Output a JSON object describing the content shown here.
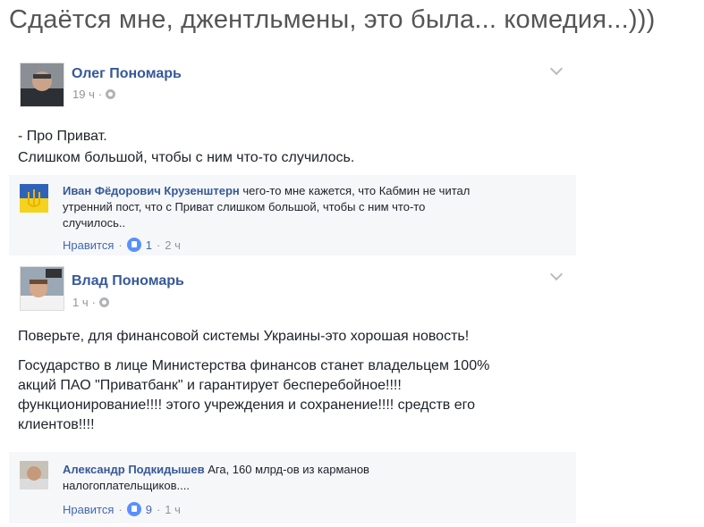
{
  "title": "Сдаётся мне, джентльмены, это была... комедия...)))",
  "post1": {
    "author": "Олег Пономарь",
    "time": "19 ч",
    "sep": "·",
    "lines": [
      "- Про Приват.",
      "Слишком большой, чтобы с ним что-то случилось."
    ],
    "comment": {
      "author": "Иван Фёдорович Крузенштерн",
      "text_line1": "чего-то мне кажется, что Кабмин не читал",
      "text_line2": "утренний пост, что с Приват слишком большой, чтобы с ним что-то",
      "text_line3": "случилось..",
      "like_label": "Нравится",
      "likes": "1",
      "time": "2 ч"
    }
  },
  "post2": {
    "author": "Влад Пономарь",
    "time": "1 ч",
    "sep": "·",
    "para1": "Поверьте, для финансовой системы Украины-это хорошая новость!",
    "para2_lines": [
      "Государство в лице Министерства финансов станет владельцем 100%",
      "акций ПАО \"Приватбанк\" и гарантирует бесперебойное!!!!",
      "функционирование!!!! этого учреждения и сохранение!!!! средств его",
      "клиентов!!!!"
    ],
    "comment": {
      "author": "Александр Подкидышев",
      "text_line1": "Ага, 160 млрд-ов из карманов",
      "text_line2": "налогоплательщиков....",
      "like_label": "Нравится",
      "likes": "9",
      "time": "1 ч"
    }
  },
  "colors": {
    "link": "#365899",
    "meta": "#90949c",
    "comment_bg": "#f6f7f9",
    "like_badge": "#5890ff",
    "flag_blue": "#2f63b8",
    "flag_yellow": "#f5d21e"
  }
}
